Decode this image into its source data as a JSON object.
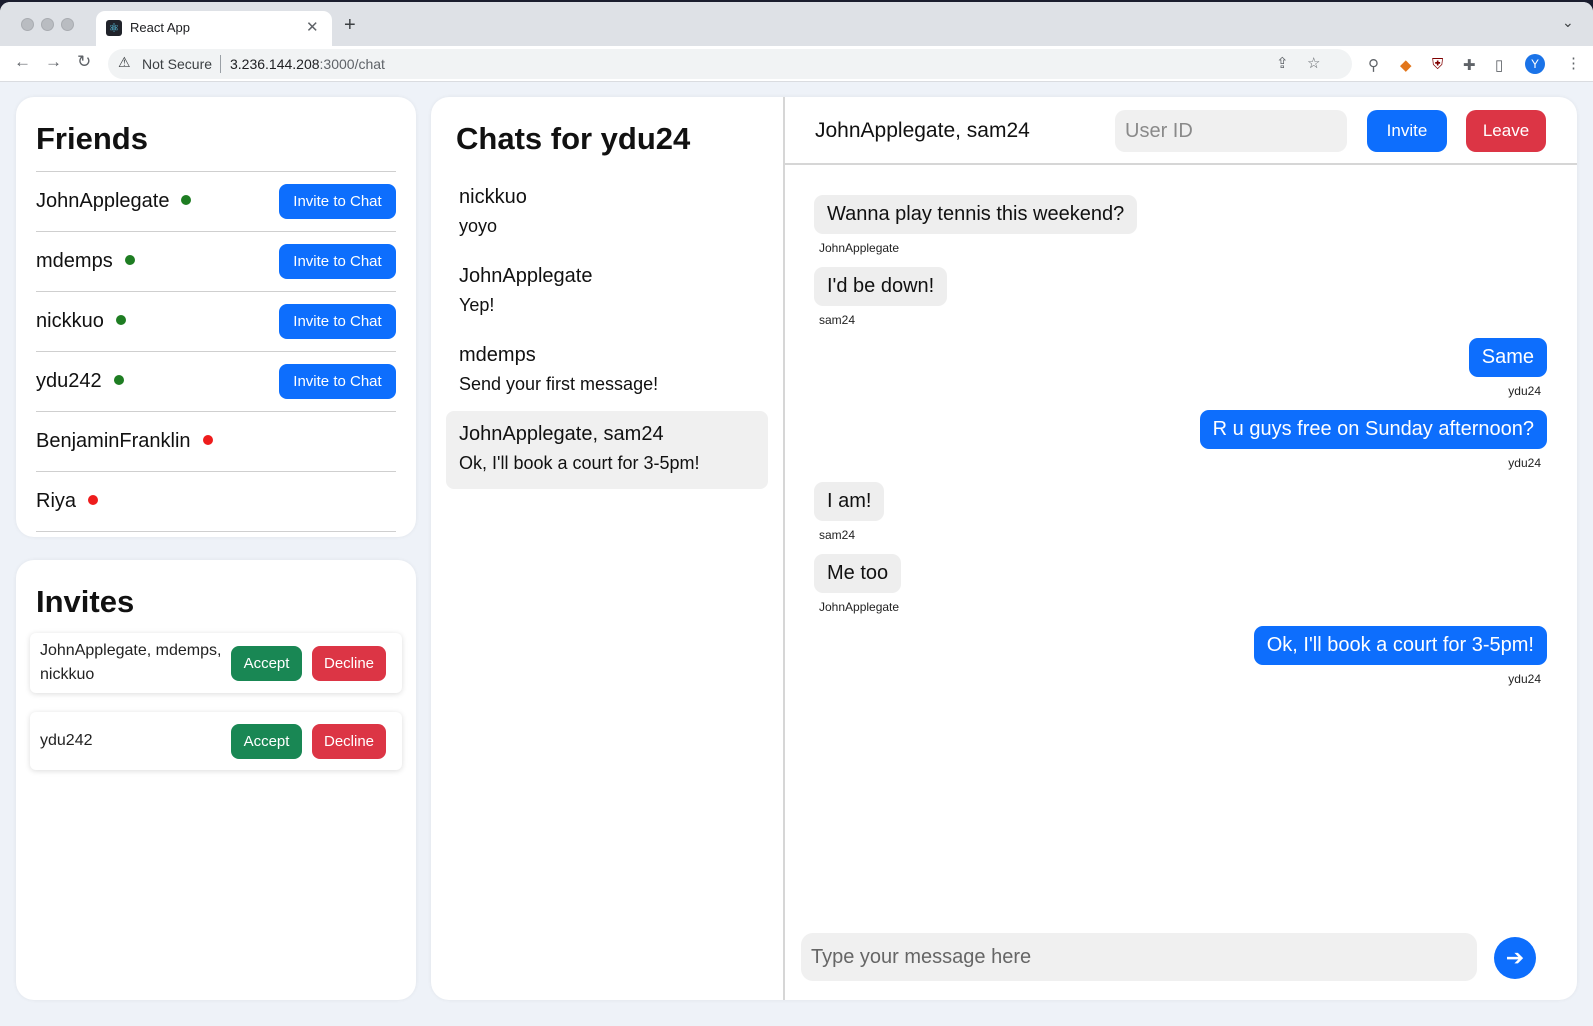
{
  "browser": {
    "tab_title": "React App",
    "security_label": "Not Secure",
    "url_host": "3.236.144.208",
    "url_path": ":3000/chat",
    "profile_initial": "Y"
  },
  "friends": {
    "title": "Friends",
    "invite_label": "Invite to Chat",
    "items": [
      {
        "name": "JohnApplegate",
        "status": "online",
        "color": "#1e7d22"
      },
      {
        "name": "mdemps",
        "status": "online",
        "color": "#1e7d22"
      },
      {
        "name": "nickkuo",
        "status": "online",
        "color": "#1e7d22"
      },
      {
        "name": "ydu242",
        "status": "online",
        "color": "#1e7d22"
      },
      {
        "name": "BenjaminFranklin",
        "status": "offline",
        "color": "#ee1c1c"
      },
      {
        "name": "Riya",
        "status": "offline",
        "color": "#ee1c1c"
      }
    ]
  },
  "invites": {
    "title": "Invites",
    "accept_label": "Accept",
    "decline_label": "Decline",
    "items": [
      {
        "names": "JohnApplegate, mdemps, nickkuo"
      },
      {
        "names": "ydu242"
      }
    ]
  },
  "chats": {
    "title": "Chats for ydu24",
    "items": [
      {
        "name": "nickkuo",
        "preview": "yoyo"
      },
      {
        "name": "JohnApplegate",
        "preview": "Yep!"
      },
      {
        "name": "mdemps",
        "preview": "Send your first message!"
      },
      {
        "name": "JohnApplegate, sam24",
        "preview": "Ok, I'll book a court for 3-5pm!"
      }
    ]
  },
  "conversation": {
    "title": "JohnApplegate, sam24",
    "userid_placeholder": "User ID",
    "invite_label": "Invite",
    "leave_label": "Leave",
    "messages": [
      {
        "text": "Wanna play tennis this weekend?",
        "sender": "JohnApplegate"
      },
      {
        "text": "I'd be down!",
        "sender": "sam24"
      },
      {
        "text": "Same",
        "sender": "ydu24"
      },
      {
        "text": "R u guys free on Sunday afternoon?",
        "sender": "ydu24"
      },
      {
        "text": "I am!",
        "sender": "sam24"
      },
      {
        "text": "Me too",
        "sender": "JohnApplegate"
      },
      {
        "text": "Ok, I'll book a court for 3-5pm!",
        "sender": "ydu24"
      }
    ],
    "message_placeholder": "Type your message here"
  },
  "colors": {
    "primary": "#0d6efd",
    "success": "#198754",
    "danger": "#dc3545",
    "online": "#1e7d22",
    "offline": "#ee1c1c"
  }
}
